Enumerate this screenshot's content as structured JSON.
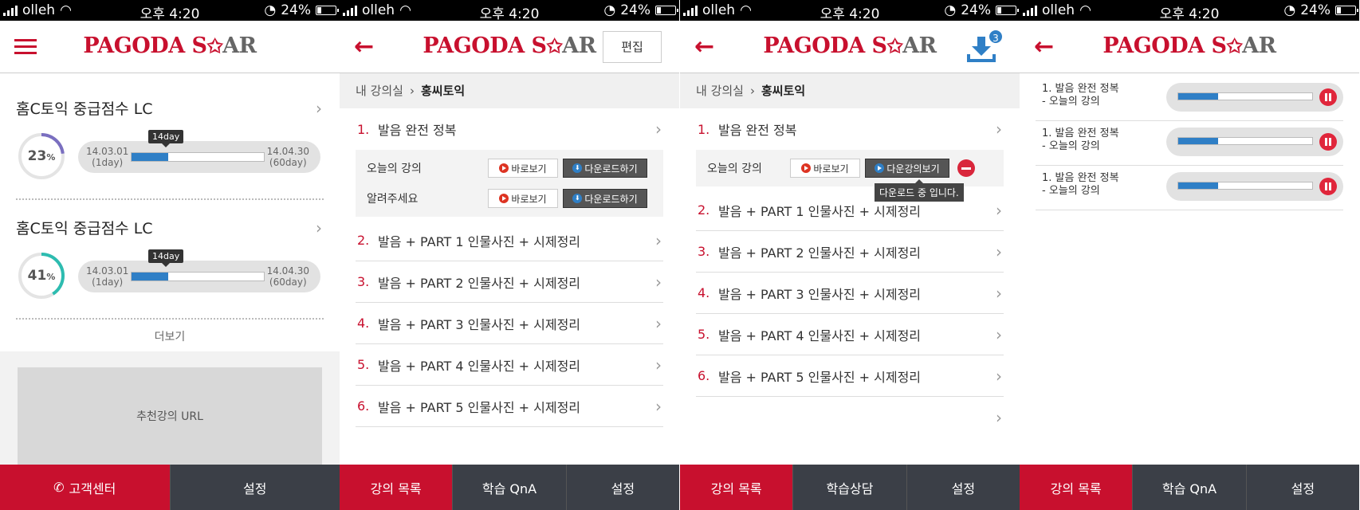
{
  "status": {
    "carrier": "olleh",
    "time": "오후 4:20",
    "battery": "24%"
  },
  "logo": {
    "part1": "PAGODA S",
    "star": "✩",
    "part2": "AR"
  },
  "screen1": {
    "courses": [
      {
        "title": "홈C토익 중급점수 LC",
        "percent": "23",
        "percent_unit": "%",
        "progress": 0.23,
        "start_date": "14.03.01",
        "start_day": "(1day)",
        "end_date": "14.04.30",
        "end_day": "(60day)",
        "tip": "14day"
      },
      {
        "title": "홈C토익 중급점수 LC",
        "percent": "41",
        "percent_unit": "%",
        "progress": 0.41,
        "start_date": "14.03.01",
        "start_day": "(1day)",
        "end_date": "14.04.30",
        "end_day": "(60day)",
        "tip": "14day"
      }
    ],
    "more": "더보기",
    "recommend": "추천강의 URL",
    "tabs": {
      "support": "고객센터",
      "settings": "설정"
    }
  },
  "screen2": {
    "edit": "편집",
    "breadcrumb": {
      "root": "내 강의실",
      "current": "홍씨토익"
    },
    "first_lecture": {
      "num": "1.",
      "title": "발음 완전 정복"
    },
    "subitems": [
      {
        "label": "오늘의 강의",
        "view": "바로보기",
        "download": "다운로드하기"
      },
      {
        "label": "알려주세요",
        "view": "바로보기",
        "download": "다운로드하기"
      }
    ],
    "lectures": [
      {
        "num": "2.",
        "title": "발음 + PART 1 인물사진 + 시제정리"
      },
      {
        "num": "3.",
        "title": "발음 + PART 2 인물사진 + 시제정리"
      },
      {
        "num": "4.",
        "title": "발음 + PART 3 인물사진 + 시제정리"
      },
      {
        "num": "5.",
        "title": "발음 + PART 4 인물사진 + 시제정리"
      },
      {
        "num": "6.",
        "title": "발음 + PART 5 인물사진 + 시제정리"
      }
    ],
    "tabs": {
      "list": "강의 목록",
      "qna": "학습 QnA",
      "settings": "설정"
    }
  },
  "screen3": {
    "badge": "3",
    "breadcrumb": {
      "root": "내 강의실",
      "current": "홍씨토익"
    },
    "first_lecture": {
      "num": "1.",
      "title": "발음 완전 정복"
    },
    "subitem": {
      "label": "오늘의 강의",
      "view": "바로보기",
      "download": "다운강의보기",
      "tooltip": "다운로드 중 입니다."
    },
    "lectures": [
      {
        "num": "2.",
        "title": "발음 + PART 1 인물사진 + 시제정리"
      },
      {
        "num": "3.",
        "title": "발음 + PART 2 인물사진 + 시제정리"
      },
      {
        "num": "4.",
        "title": "발음 + PART 3 인물사진 + 시제정리"
      },
      {
        "num": "5.",
        "title": "발음 + PART 4 인물사진 + 시제정리"
      },
      {
        "num": "6.",
        "title": "발음 + PART 5 인물사진 + 시제정리"
      }
    ],
    "tabs": {
      "list": "강의 목록",
      "consult": "학습상담",
      "settings": "설정"
    }
  },
  "screen4": {
    "downloads": [
      {
        "line1": "1. 발음 완전 정복",
        "line2": "- 오늘의 강의",
        "progress": 0.3
      },
      {
        "line1": "1. 발음 완전 정복",
        "line2": "- 오늘의 강의",
        "progress": 0.3
      },
      {
        "line1": "1. 발음 완전 정복",
        "line2": "- 오늘의 강의",
        "progress": 0.3
      }
    ],
    "tabs": {
      "list": "강의 목록",
      "qna": "학습 QnA",
      "settings": "설정"
    }
  },
  "colors": {
    "brand_red": "#c8102e",
    "progress_blue": "#2f7fc6",
    "tabbar_dark": "#3b3f47"
  }
}
